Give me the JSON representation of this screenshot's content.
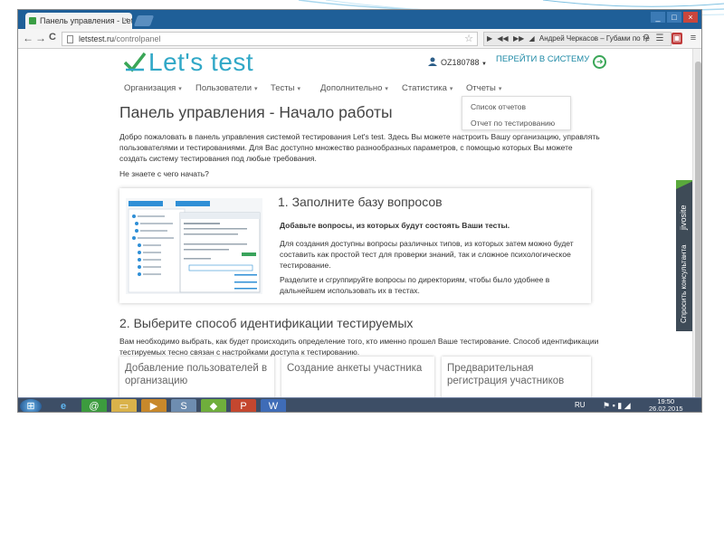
{
  "browser": {
    "tab_title": "Панель управления - Let's",
    "tab_close": "×",
    "window_controls": [
      "_",
      "□",
      "×"
    ],
    "url_domain": "letstest.ru",
    "url_path": "/controlpanel",
    "star_icon": "☆",
    "media_controls": [
      "▶",
      "◀◀",
      "▶▶"
    ],
    "media_track": "Андрей Черкасов – Губами по те",
    "nav_back": "←",
    "nav_forward": "→",
    "nav_reload": "C"
  },
  "site": {
    "logo_text": "Let's test",
    "brand_color": "#31a8c7",
    "accent_green": "#3aa657",
    "user_id": "OZ180788",
    "user_caret": "▼",
    "enter_label": "ПЕРЕЙТИ В СИСТЕМУ",
    "enter_arrow": "➜",
    "menu": [
      {
        "label": "Организация",
        "caret": "▾"
      },
      {
        "label": "Пользователи",
        "caret": "▾"
      },
      {
        "label": "Тесты",
        "caret": "▾"
      },
      {
        "label": "Дополнительно",
        "caret": "▾"
      },
      {
        "label": "Статистика",
        "caret": "▾"
      },
      {
        "label": "Отчеты",
        "caret": "▾"
      }
    ],
    "reports_dropdown": [
      "Список отчетов",
      "Отчет по тестированию"
    ]
  },
  "main": {
    "title": "Панель управления - Начало работы",
    "intro_lines": [
      "Добро пожаловать в панель управления системой тестирования Let's test. Здесь Вы можете настроить Вашу организацию, управлять",
      "пользователями и тестированиями. Для Вас доступно множество разнообразных параметров, с помощью которых Вы можете",
      "создать систему тестирования под любые требования."
    ],
    "question": "Не знаете с чего начать?",
    "step1": {
      "heading": "1. Заполните базу вопросов",
      "bold": "Добавьте вопросы, из которых будут состоять Ваши тесты.",
      "lines_a": [
        "Для создания доступны вопросы различных типов, из которых затем можно будет",
        "составить как простой тест для проверки знаний, так и сложное психологическое",
        "тестирование."
      ],
      "lines_b": [
        "Разделите и сгруппируйте вопросы по директориям, чтобы было удобнее в",
        "дальнейшем использовать их в тестах."
      ]
    },
    "step2": {
      "heading": "2. Выберите способ идентификации тестируемых",
      "lines": [
        "Вам необходимо выбрать, как будет происходить определение того, кто именно прошел Ваше тестирование. Способ идентификации",
        "тестируемых тесно связан с настройками доступа к тестированию."
      ],
      "options": [
        "Добавление пользователей в организацию",
        "Создание анкеты участника",
        "Предварительная регистрация участников"
      ]
    }
  },
  "widget": {
    "label": "Спросить консультанта",
    "brand": "jivosite"
  },
  "taskbar": {
    "lang": "RU",
    "time": "19:50",
    "date": "26.02.2015"
  }
}
